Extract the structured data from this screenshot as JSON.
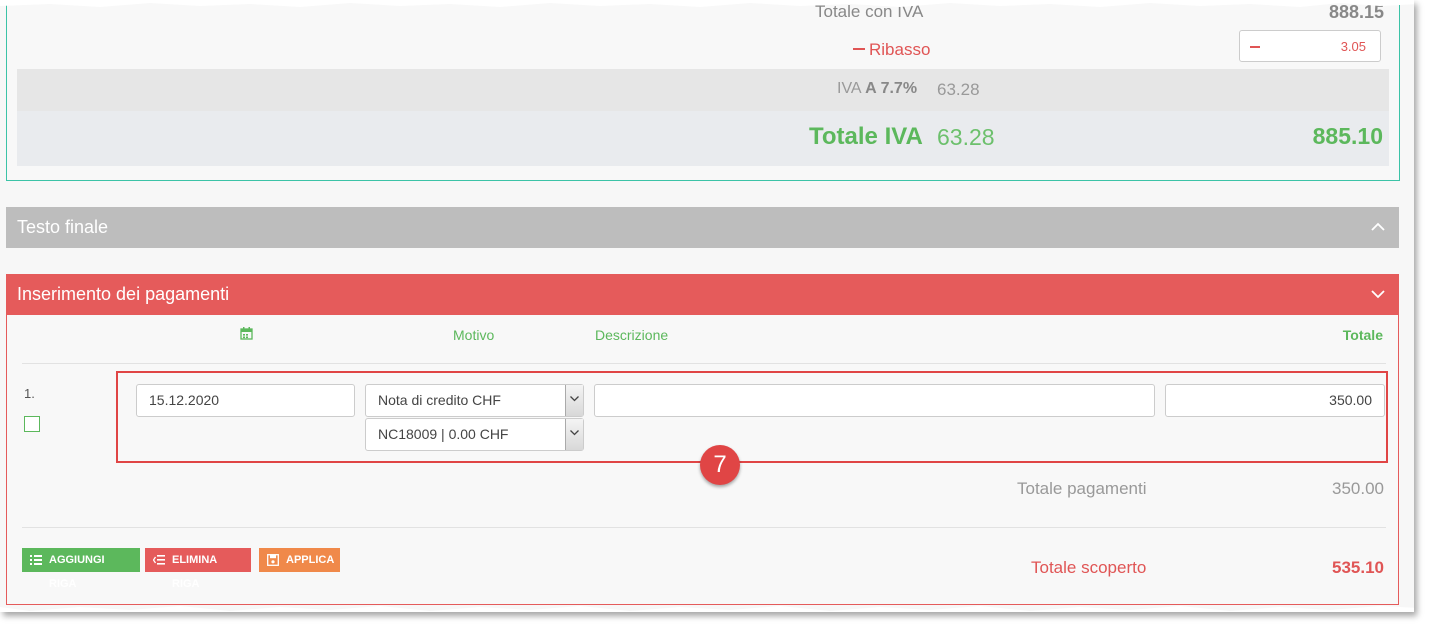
{
  "totals": {
    "totale_con_iva_label": "Totale con IVA",
    "totale_con_iva_value": "888.15",
    "ribasso_label": "Ribasso",
    "ribasso_value": "3.05",
    "iva_label_prefix": "IVA",
    "iva_rate": "A 7.7%",
    "iva_value": "63.28",
    "totale_iva_label": "Totale IVA",
    "totale_iva_value": "63.28",
    "grand_total": "885.10"
  },
  "sections": {
    "testo_finale": "Testo finale",
    "pagamenti": "Inserimento dei pagamenti"
  },
  "payments": {
    "columns": {
      "motivo": "Motivo",
      "descrizione": "Descrizione",
      "totale": "Totale"
    },
    "rows": [
      {
        "number": "1.",
        "date": "15.12.2020",
        "motivo": "Nota di credito CHF",
        "documento": "NC18009 | 0.00 CHF",
        "descrizione": "",
        "totale": "350.00"
      }
    ],
    "callout_number": "7",
    "totale_pagamenti_label": "Totale pagamenti",
    "totale_pagamenti_value": "350.00",
    "totale_scoperto_label": "Totale scoperto",
    "totale_scoperto_value": "535.10"
  },
  "buttons": {
    "add_row": "AGGIUNGI RIGA",
    "delete_row": "ELIMINA RIGA",
    "apply": "APPLICA"
  },
  "colors": {
    "green": "#5cb85c",
    "red": "#e55b5b",
    "orange": "#f0894a",
    "gray_header": "#bdbdbd",
    "teal_border": "#3cc3a7"
  },
  "icons": [
    "calendar-icon",
    "chevron-up-icon",
    "chevron-down-icon",
    "add-row-icon",
    "delete-row-icon",
    "save-icon"
  ]
}
